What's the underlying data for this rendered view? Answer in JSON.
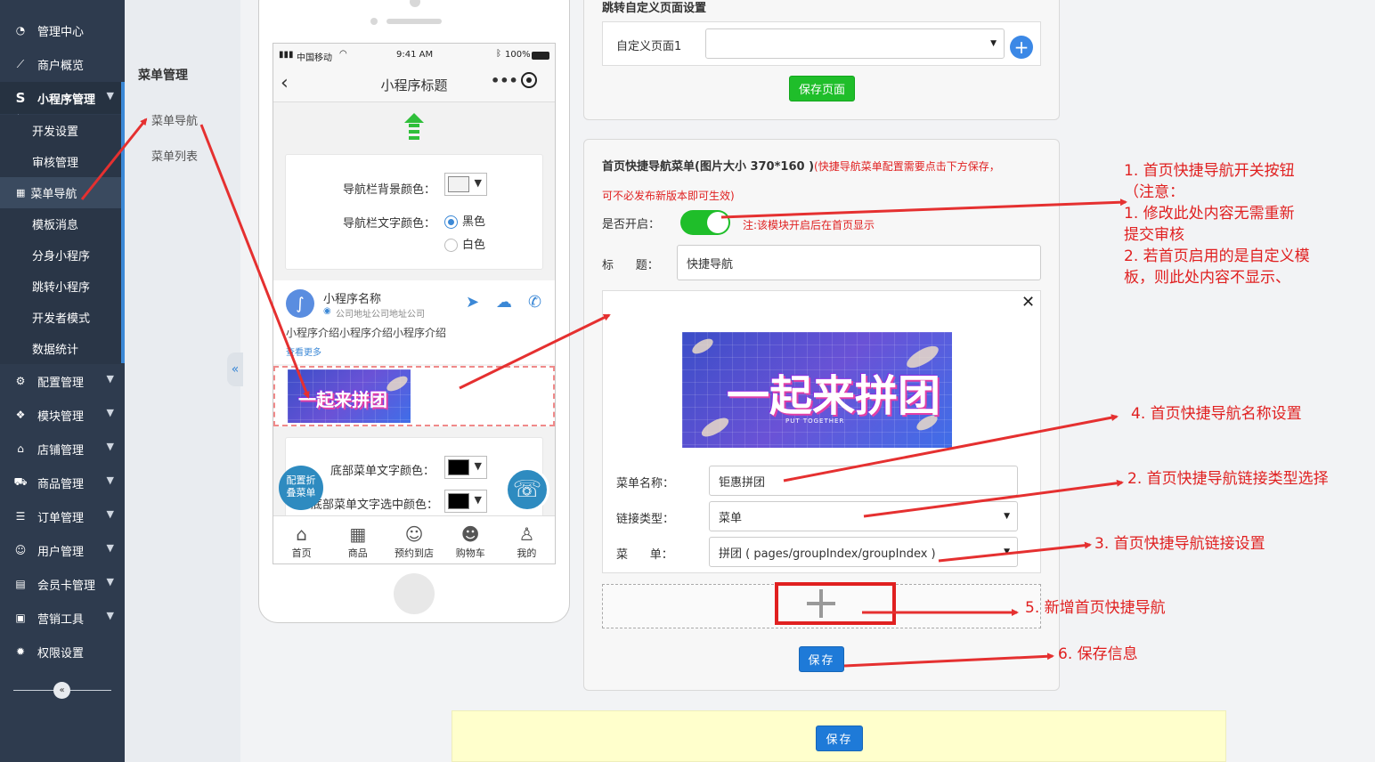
{
  "sidebar": {
    "items": [
      {
        "label": "管理中心",
        "icon": "dashboard-icon"
      },
      {
        "label": "商户概览",
        "icon": "chart-line-icon"
      },
      {
        "label": "小程序管理",
        "icon": "s-logo-icon"
      },
      {
        "label": "配置管理",
        "icon": "gears-icon"
      },
      {
        "label": "模块管理",
        "icon": "cubes-icon"
      },
      {
        "label": "店铺管理",
        "icon": "bank-icon"
      },
      {
        "label": "商品管理",
        "icon": "cart-icon"
      },
      {
        "label": "订单管理",
        "icon": "list-icon"
      },
      {
        "label": "用户管理",
        "icon": "user-icon"
      },
      {
        "label": "会员卡管理",
        "icon": "card-icon"
      },
      {
        "label": "营销工具",
        "icon": "briefcase-icon"
      },
      {
        "label": "权限设置",
        "icon": "gear-icon"
      }
    ],
    "sub_items": [
      "开发设置",
      "审核管理",
      "菜单导航",
      "模板消息",
      "分身小程序",
      "跳转小程序",
      "开发者模式",
      "数据统计"
    ],
    "collapse_glyph": "«"
  },
  "secondary": {
    "title": "菜单管理",
    "items": [
      "菜单导航",
      "菜单列表"
    ],
    "collapse_glyph": "«"
  },
  "phone": {
    "status": {
      "carrier": "中国移动",
      "time": "9:41 AM",
      "battery": "100%"
    },
    "title": "小程序标题",
    "nav_bg_label": "导航栏背景颜色：",
    "nav_text_label": "导航栏文字颜色：",
    "opt_black": "黑色",
    "opt_white": "白色",
    "shop_name": "小程序名称",
    "shop_address": "公司地址公司地址公司",
    "shop_intro": "小程序介绍小程序介绍小程序介绍",
    "see_more": "查看更多",
    "banner_text": "一起来拼团",
    "banner_sub": "PUT TOGETHER",
    "bottom_text_label": "底部菜单文字颜色：",
    "bottom_active_label": "底部菜单文字选中颜色：",
    "fold_menu_label": "配置折叠菜单",
    "tabs": [
      "首页",
      "商品",
      "预约到店",
      "购物车",
      "我的"
    ]
  },
  "custom_page": {
    "title": "跳转自定义页面设置",
    "field_label": "自定义页面1",
    "field_value": "",
    "save_label": "保存页面"
  },
  "quick_nav": {
    "title": "首页快捷导航菜单(图片大小 370*160 )",
    "note_1": "(快捷导航菜单配置需要点击下方保存，",
    "note_2": "可不必发布新版本即可生效)",
    "enable_label": "是否开启：",
    "enable_note": "注:该模块开启后在首页显示",
    "title_label": "标      题：",
    "title_value": "快捷导航",
    "item": {
      "name_label": "菜单名称：",
      "name_value": "钜惠拼团",
      "link_type_label": "链接类型：",
      "link_type_value": "菜单",
      "menu_label": "菜      单：",
      "menu_value": "拼团  ( pages/groupIndex/groupIndex )"
    },
    "save_label": "保存"
  },
  "footer": {
    "save_label": "保存"
  },
  "annotations": {
    "a1": [
      "1.  首页快捷导航开关按钮",
      "（注意：",
      "1.  修改此处内容无需重新",
      "提交审核",
      "2.  若首页启用的是自定义模",
      "板，则此处内容不显示、"
    ],
    "a4": "4.  首页快捷导航名称设置",
    "a2": "2.  首页快捷导航链接类型选择",
    "a3": "3.  首页快捷导航链接设置",
    "a5": "5.  新增首页快捷导航",
    "a6": "6.  保存信息"
  },
  "colors": {
    "sidebar_bg": "#2e3b4e",
    "accent_blue": "#1e7ad8",
    "green": "#1fbe2a",
    "annotation_red": "#e02020",
    "footer_bg": "#ffffcc"
  }
}
